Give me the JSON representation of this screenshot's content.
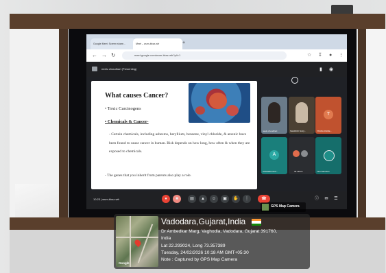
{
  "browser": {
    "tabs": [
      {
        "label": "Google Meet: Screen share..."
      },
      {
        "label": "Meet – wum-bksz-wfr"
      }
    ],
    "new_tab": "+",
    "url": "meet.google.com/wum-bksz-wfr?pli=1"
  },
  "meet": {
    "presenting_label": "neelu choudhari (Presenting)",
    "meeting_info": "10:23  |  wum-bksz-wfr",
    "participants": [
      {
        "name": "neelu choudhari"
      },
      {
        "name": "SHARIOF NAQ..."
      },
      {
        "name": "TANNA JIGNE..."
      },
      {
        "name": "ACHARIO RUI...",
        "initial": "A"
      },
      {
        "name": "33 others"
      },
      {
        "name": "Tina Sabuban"
      }
    ],
    "avatar_initials": {
      "t3": "T"
    }
  },
  "slide": {
    "title": "What causes Cancer?",
    "bullet1": "• Toxic Carcinogens",
    "bullet2": "• Chemicals & Cancer-",
    "paragraph1": "- Certain chemicals, including asbestos, beryllium, benzene, vinyl chloride, & arsenic have been found to cause cancer in human. Risk depends on how long, how often & when they are exposed to chemicals.",
    "paragraph2": "- The genes that you inherit from parents also play a role."
  },
  "gps": {
    "badge_label": "GPS Map Camera",
    "title": "Vadodara,Gujarat,India",
    "address_line1": "Dr Ambedkar Marg, Vaghodia, Vadodara, Gujarat 391760,",
    "address_line2": "India",
    "lat_long": "Lat 22.293024, Long 73.357389",
    "datetime": "Tuesday, 24/02/2026 10:18 AM GMT+05:30",
    "note": "Note : Captured by GPS Map Camera",
    "map_brand": "Google",
    "flag_colors": [
      "#ff9933",
      "#ffffff",
      "#138808"
    ]
  }
}
